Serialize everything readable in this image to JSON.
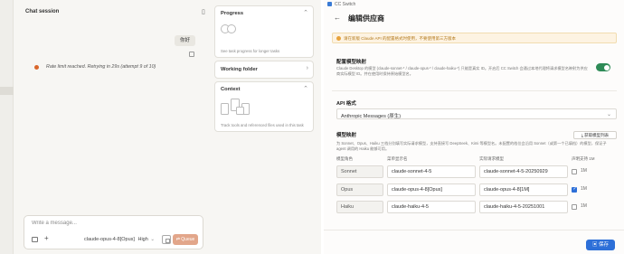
{
  "left": {
    "session_title": "Chat session",
    "user_message": "你好",
    "rate_limit": "Rate limit reached. Retrying in 29s (attempt 9 of 10)",
    "composer": {
      "placeholder": "Write a message...",
      "model": "claude-opus-4-8[Opus]",
      "effort": "High",
      "queue_label": "Queue"
    },
    "panels": {
      "progress": {
        "title": "Progress",
        "desc": "See task progress for longer tasks"
      },
      "working_folder": {
        "title": "Working folder"
      },
      "context": {
        "title": "Context",
        "desc": "Track tools and referenced files used in this task"
      }
    }
  },
  "right": {
    "window_title": "CC Switch",
    "page_title": "编辑供应商",
    "warning": "请在新版 Claude API 的配置格式时使用，不要使用第三方版本",
    "toggle_section": {
      "label": "配置模型映射",
      "desc": "Claude Desktop 的模型 (claude-sonnet-* / claude-opus-* / claude-haiku-*) 只能是真实 ID。开启后 CC Switch 会通过本地代理将请求模型名映射为供应商实际模型 ID。并在使用时保持原始模型名。",
      "enabled": true
    },
    "api_format": {
      "label": "API 格式",
      "value": "Anthropic Messages (原生)"
    },
    "mapping": {
      "label": "模型映射",
      "desc": "为 Sonnet、Opus、Haiku 三档分别填写实际请求模型，支持直接写 DeepSeek、Kimi 等模型名。未配置的档位会沿用 Sonnet（或第一个已填档）的模型，保证子 agent 调用的 Haiku 能够可用。",
      "fetch_button": "获取模型列表",
      "headers": [
        "模型角色",
        "菜单显示名",
        "实际请求模型",
        "声明支持 1M"
      ],
      "rows": [
        {
          "role": "Sonnet",
          "display": "claude-sonnet-4-5",
          "actual": "claude-sonnet-4-5-20250929",
          "supports_1m": false,
          "label_1m": "1M"
        },
        {
          "role": "Opus",
          "display": "claude-opus-4-8[Opus]",
          "actual": "claude-opus-4-8[1M]",
          "supports_1m": true,
          "label_1m": "1M"
        },
        {
          "role": "Haiku",
          "display": "claude-haiku-4-5",
          "actual": "claude-haiku-4-5-20251001",
          "supports_1m": false,
          "label_1m": "1M"
        }
      ]
    },
    "save_label": "保存",
    "colors": {
      "accent": "#2d6fd8",
      "toggle_on": "#2e8b57",
      "warning": "#e8a23a"
    }
  }
}
